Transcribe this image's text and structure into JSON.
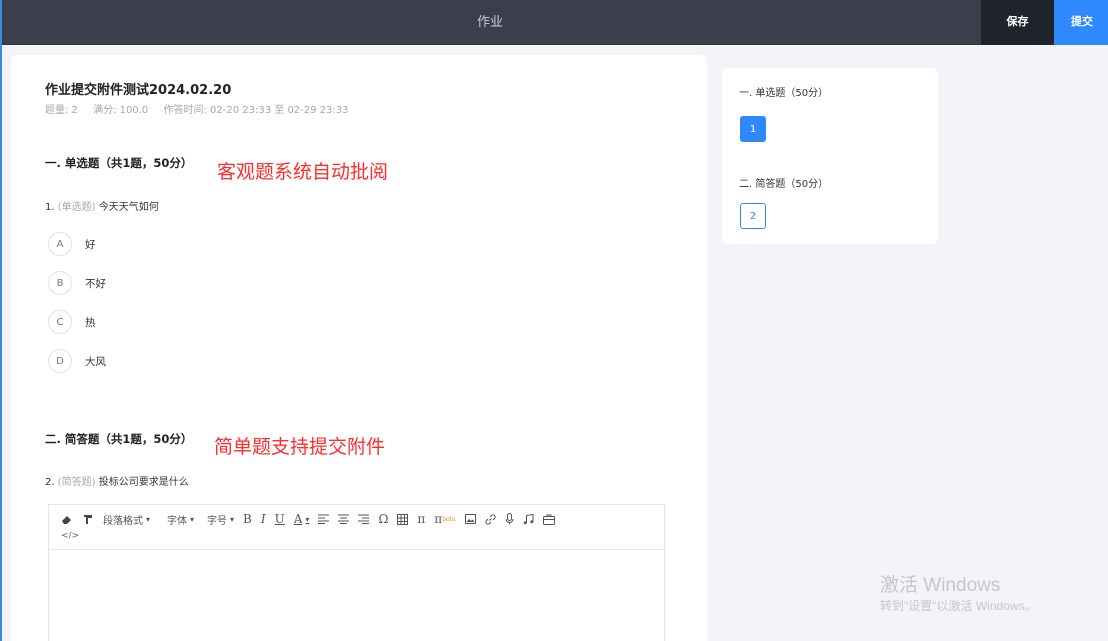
{
  "header": {
    "title": "作业",
    "save_label": "保存",
    "submit_label": "提交"
  },
  "homework": {
    "title": "作业提交附件测试2024.02.20",
    "meta_count": "题量: 2",
    "meta_score": "满分: 100.0",
    "meta_time": "作答时间: 02-20 23:33 至 02-29 23:33"
  },
  "section1": {
    "title": "一. 单选题（共1题，50分）",
    "annotation": "客观题系统自动批阅",
    "question": {
      "number": "1.",
      "type": "(单选题)",
      "text": "今天天气如何"
    },
    "options": [
      {
        "letter": "A",
        "text": "好"
      },
      {
        "letter": "B",
        "text": "不好"
      },
      {
        "letter": "C",
        "text": "热"
      },
      {
        "letter": "D",
        "text": "大风"
      }
    ]
  },
  "section2": {
    "title": "二. 简答题（共1题，50分）",
    "annotation": "简单题支持提交附件",
    "question": {
      "number": "2.",
      "type": "(简答题)",
      "text": "投标公司要求是什么"
    }
  },
  "editor": {
    "toolbar": {
      "paragraph": "段落格式",
      "font": "字体",
      "size": "字号",
      "bold": "B",
      "italic": "I",
      "underline": "U",
      "color": "A",
      "omega": "Ω",
      "pi": "π",
      "pi_beta": "π",
      "beta": "beta",
      "code": "</>"
    }
  },
  "sidebar": {
    "section1_title": "一. 单选题（50分）",
    "section1_num": "1",
    "section2_title": "二. 简答题（50分）",
    "section2_num": "2"
  },
  "watermark": {
    "line1": "激活 Windows",
    "line2": "转到\"设置\"以激活 Windows。"
  },
  "colors": {
    "accent": "#2f89fc",
    "topbar": "#3a3f4b",
    "annotation": "#ff2d2d"
  }
}
